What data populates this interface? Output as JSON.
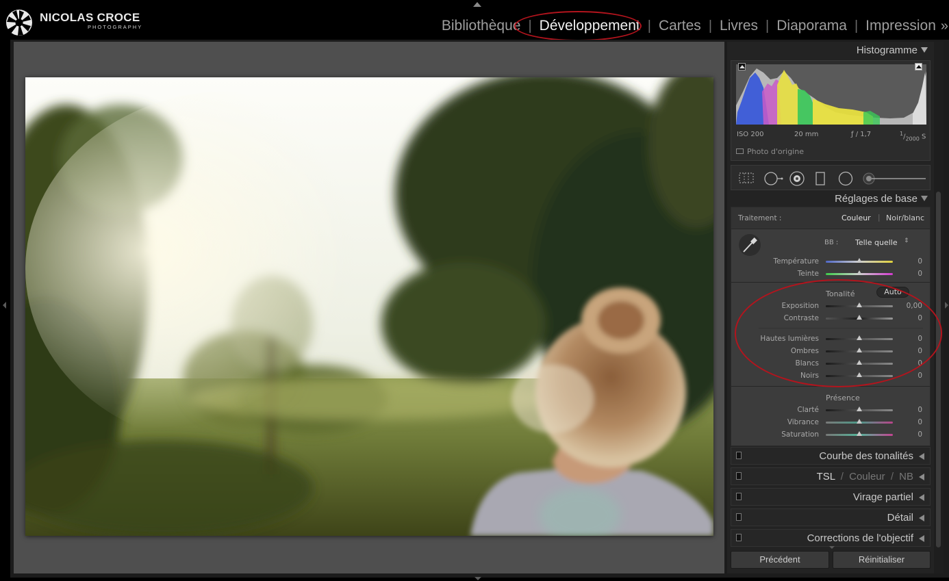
{
  "brand": {
    "name": "NICOLAS CROCE",
    "tagline": "PHOTOGRAPHY"
  },
  "modules": {
    "items": [
      "Bibliothèque",
      "Développement",
      "Cartes",
      "Livres",
      "Diaporama",
      "Impression"
    ],
    "active": "Développement",
    "more": "»"
  },
  "histogram": {
    "title": "Histogramme",
    "iso": "ISO 200",
    "focal": "20 mm",
    "aperture": "ƒ / 1,7",
    "shutter_num": "1",
    "shutter_den": "2000",
    "shutter_unit": "S",
    "original_label": "Photo d'origine"
  },
  "basic": {
    "title": "Réglages de base",
    "treatment_label": "Traitement :",
    "treatment_color": "Couleur",
    "treatment_bw": "Noir/blanc",
    "wb_label": "BB :",
    "wb_value": "Telle quelle",
    "temperature": {
      "label": "Température",
      "value": "0"
    },
    "tint": {
      "label": "Teinte",
      "value": "0"
    },
    "tone_label": "Tonalité",
    "auto_label": "Auto",
    "exposure": {
      "label": "Exposition",
      "value": "0,00"
    },
    "contrast": {
      "label": "Contraste",
      "value": "0"
    },
    "highlights": {
      "label": "Hautes lumières",
      "value": "0"
    },
    "shadows": {
      "label": "Ombres",
      "value": "0"
    },
    "whites": {
      "label": "Blancs",
      "value": "0"
    },
    "blacks": {
      "label": "Noirs",
      "value": "0"
    },
    "presence_label": "Présence",
    "clarity": {
      "label": "Clarté",
      "value": "0"
    },
    "vibrance": {
      "label": "Vibrance",
      "value": "0"
    },
    "saturation": {
      "label": "Saturation",
      "value": "0"
    }
  },
  "panels": {
    "tone_curve": "Courbe des tonalités",
    "hsl": "TSL",
    "hsl_color": "Couleur",
    "hsl_bw": "NB",
    "hsl_sep": "/",
    "split_toning": "Virage partiel",
    "detail": "Détail",
    "lens": "Corrections de l'objectif"
  },
  "footer": {
    "previous": "Précédent",
    "reset": "Réinitialiser"
  },
  "colors": {
    "accent_ring": "#b3141d",
    "panel_bg": "#3c3c3c",
    "canvas_bg": "#4f4f4f"
  }
}
